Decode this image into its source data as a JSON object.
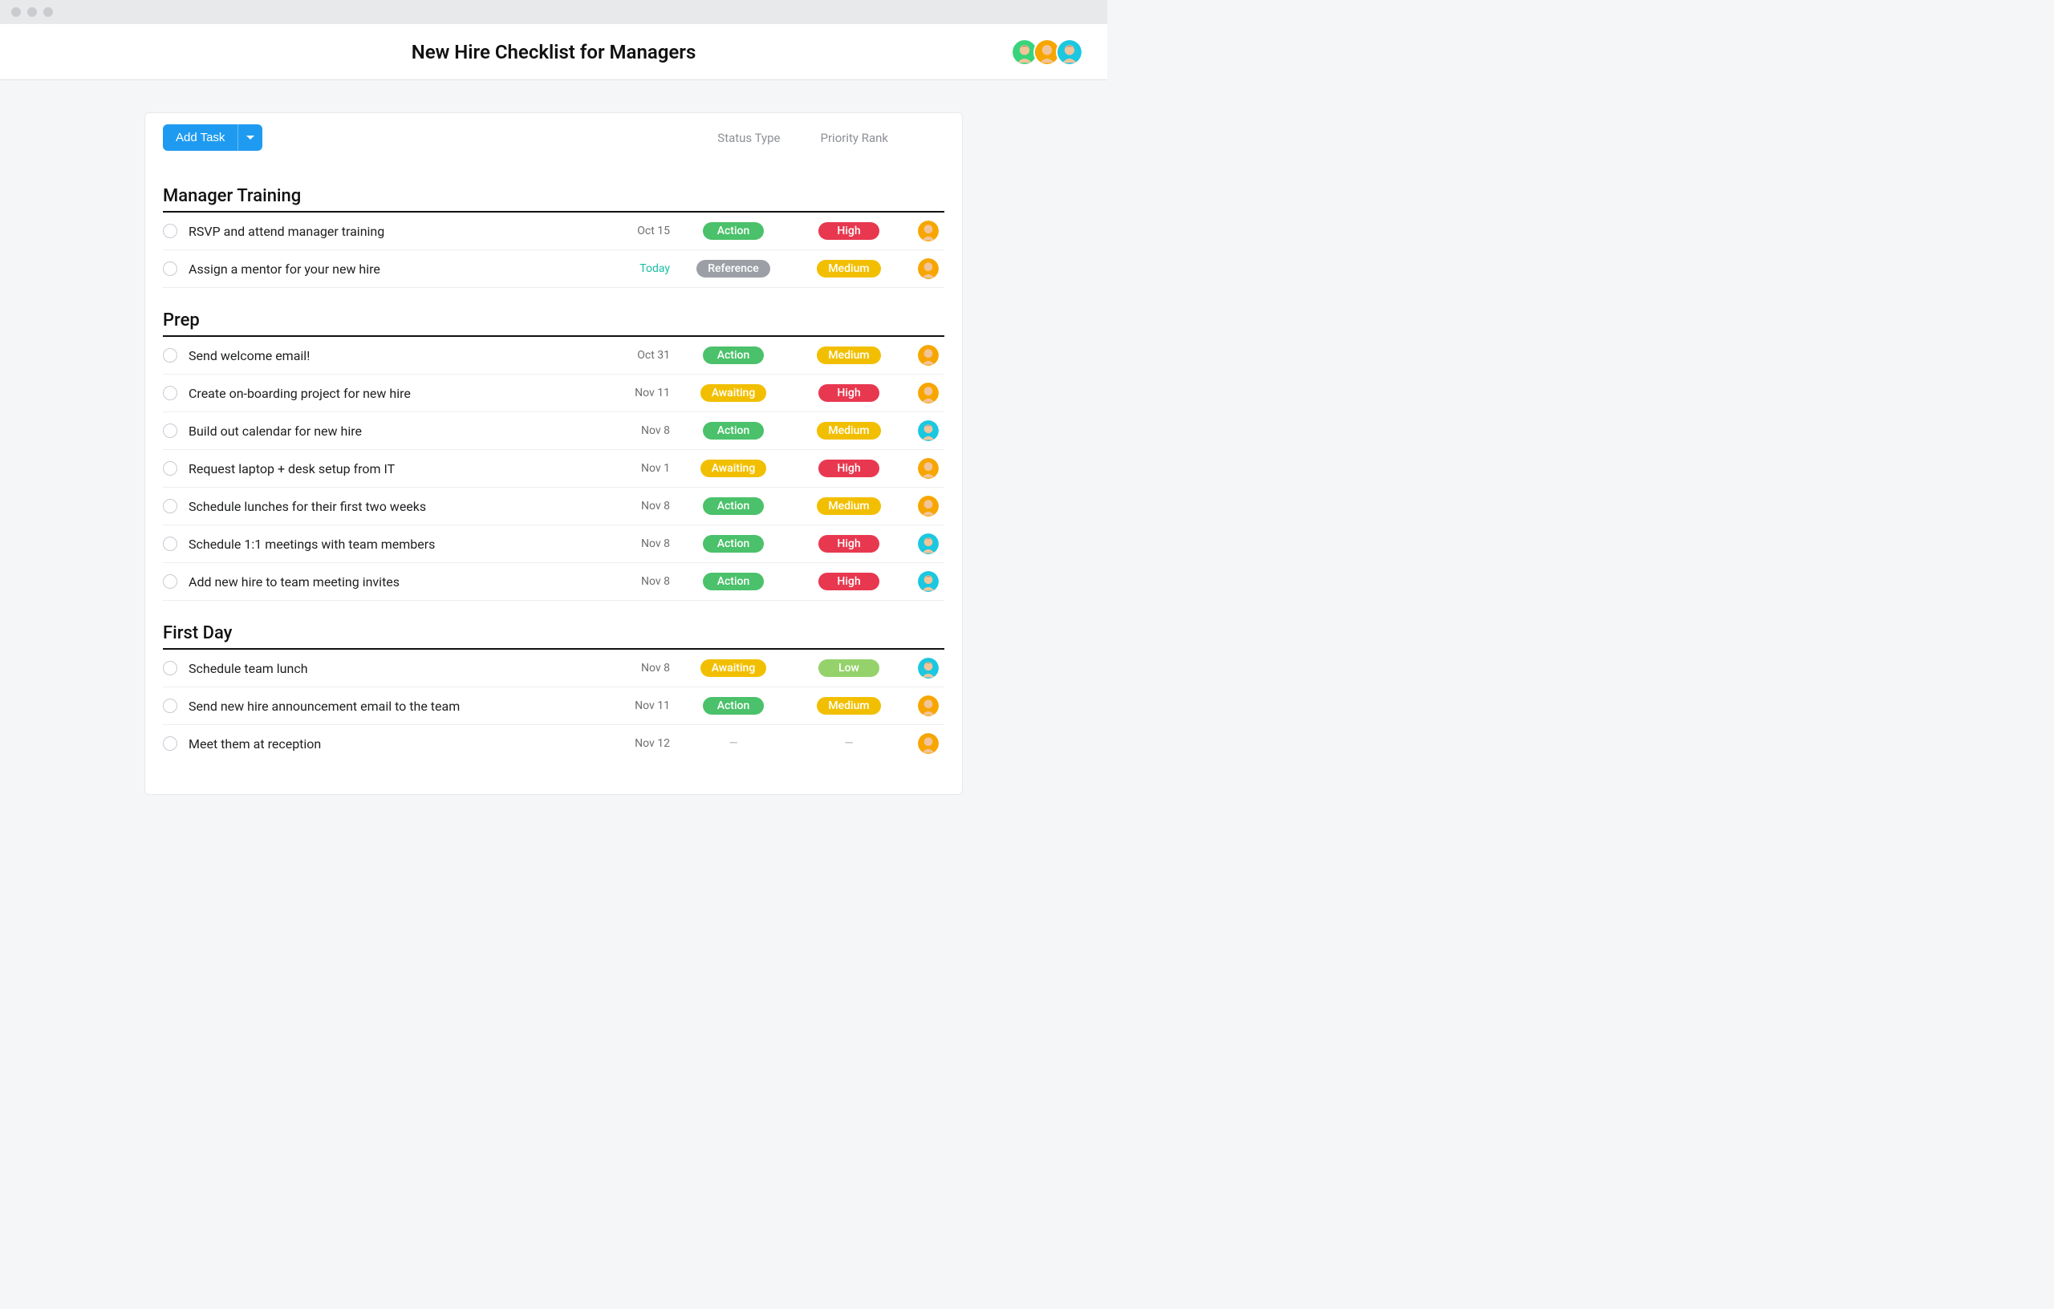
{
  "header": {
    "title": "New Hire Checklist for Managers"
  },
  "collaborators": [
    {
      "color": "green"
    },
    {
      "color": "orange"
    },
    {
      "color": "blue"
    }
  ],
  "toolbar": {
    "add_task_label": "Add Task"
  },
  "columns": {
    "status": "Status Type",
    "priority": "Priority Rank"
  },
  "status_labels": {
    "action": "Action",
    "reference": "Reference",
    "awaiting": "Awaiting"
  },
  "priority_labels": {
    "high": "High",
    "medium": "Medium",
    "low": "Low"
  },
  "sections": [
    {
      "title": "Manager Training",
      "tasks": [
        {
          "name": "RSVP and attend manager training",
          "date": "Oct 15",
          "today": false,
          "status": "action",
          "priority": "high",
          "assignee": "orange"
        },
        {
          "name": "Assign a mentor for your new hire",
          "date": "Today",
          "today": true,
          "status": "reference",
          "priority": "medium",
          "assignee": "orange"
        }
      ]
    },
    {
      "title": "Prep",
      "tasks": [
        {
          "name": "Send welcome email!",
          "date": "Oct 31",
          "today": false,
          "status": "action",
          "priority": "medium",
          "assignee": "orange"
        },
        {
          "name": "Create on-boarding project for new hire",
          "date": "Nov 11",
          "today": false,
          "status": "awaiting",
          "priority": "high",
          "assignee": "orange"
        },
        {
          "name": "Build out calendar for new hire",
          "date": "Nov 8",
          "today": false,
          "status": "action",
          "priority": "medium",
          "assignee": "blue"
        },
        {
          "name": "Request laptop + desk setup from IT",
          "date": "Nov 1",
          "today": false,
          "status": "awaiting",
          "priority": "high",
          "assignee": "orange"
        },
        {
          "name": "Schedule lunches for their first two weeks",
          "date": "Nov 8",
          "today": false,
          "status": "action",
          "priority": "medium",
          "assignee": "orange"
        },
        {
          "name": "Schedule 1:1 meetings with team members",
          "date": "Nov 8",
          "today": false,
          "status": "action",
          "priority": "high",
          "assignee": "blue"
        },
        {
          "name": "Add new hire to team meeting invites",
          "date": "Nov 8",
          "today": false,
          "status": "action",
          "priority": "high",
          "assignee": "blue"
        }
      ]
    },
    {
      "title": "First Day",
      "tasks": [
        {
          "name": "Schedule team lunch",
          "date": "Nov 8",
          "today": false,
          "status": "awaiting",
          "priority": "low",
          "assignee": "blue"
        },
        {
          "name": "Send new hire announcement email to the team",
          "date": "Nov 11",
          "today": false,
          "status": "action",
          "priority": "medium",
          "assignee": "orange"
        },
        {
          "name": "Meet them at reception",
          "date": "Nov 12",
          "today": false,
          "status": null,
          "priority": null,
          "assignee": "orange"
        }
      ]
    }
  ],
  "avatar_colors": {
    "green": {
      "ring": "#38d47c",
      "face": "#f2c49a",
      "hair": "#4a2d10"
    },
    "orange": {
      "ring": "#f7a600",
      "face": "#f2c49a",
      "hair": "#f4d88a"
    },
    "blue": {
      "ring": "#1cc7e0",
      "face": "#f2c49a",
      "hair": "#3b3026"
    }
  }
}
